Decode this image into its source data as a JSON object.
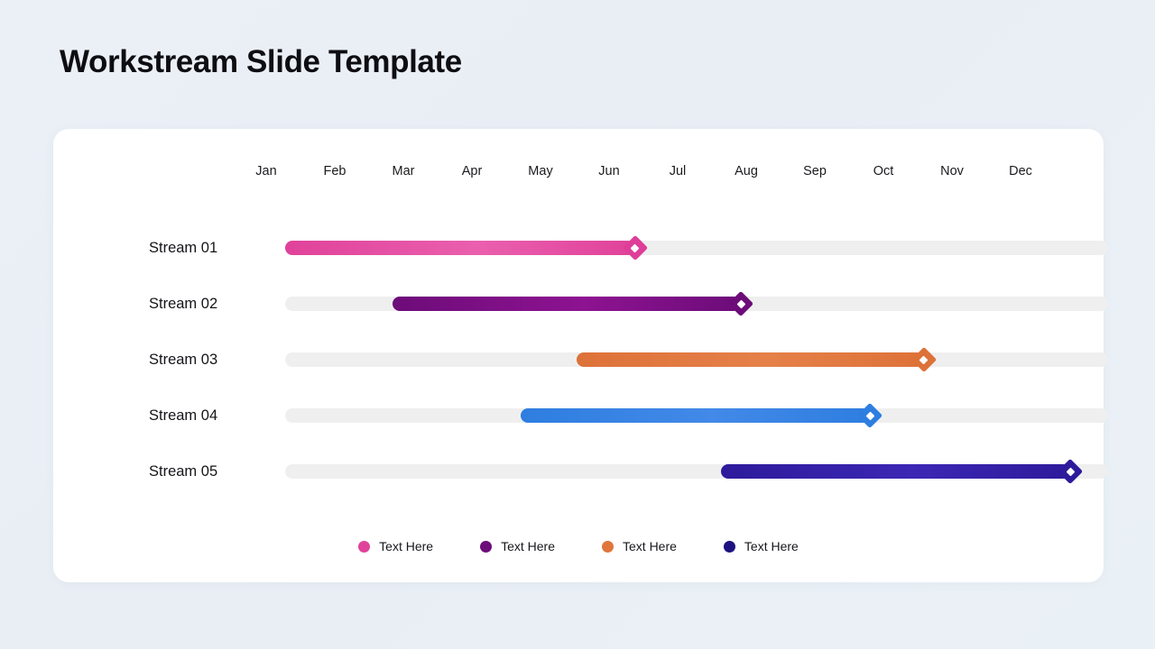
{
  "page": {
    "title": "Workstream Slide Template",
    "background_color": "#eaf0f6",
    "card_color": "#ffffff"
  },
  "timeline": {
    "track_color": "#efefef",
    "months": [
      "Jan",
      "Feb",
      "Mar",
      "Apr",
      "May",
      "Jun",
      "Jul",
      "Aug",
      "Sep",
      "Oct",
      "Nov",
      "Dec"
    ],
    "rows": [
      {
        "label": "Stream 01",
        "start_month": "Jan",
        "end_month": "Jun",
        "start_pct": 0,
        "end_pct": 42.5,
        "color": "#e0429a",
        "color_light": "#ea5fae",
        "marker_color": "#de3e98",
        "marker_inner_color": "#ffffff"
      },
      {
        "label": "Stream 02",
        "start_month": "Mar",
        "end_month": "Jul",
        "start_pct": 13.0,
        "end_pct": 55.4,
        "color": "#6d0c79",
        "color_light": "#8d1391",
        "marker_color": "#6d0c79",
        "marker_inner_color": "#ffffff"
      },
      {
        "label": "Stream 03",
        "start_month": "May",
        "end_month": "Oct",
        "start_pct": 35.4,
        "end_pct": 77.6,
        "color": "#dd7239",
        "color_light": "#e58049",
        "marker_color": "#dd7239",
        "marker_inner_color": "#ffffff"
      },
      {
        "label": "Stream 04",
        "start_month": "Apr",
        "end_month": "Sep",
        "start_pct": 28.6,
        "end_pct": 71.1,
        "color": "#2e7ee0",
        "color_light": "#4289e8",
        "marker_color": "#2e7ee0",
        "marker_inner_color": "#ffffff"
      },
      {
        "label": "Stream 05",
        "start_month": "Aug",
        "end_month": "Dec",
        "start_pct": 53.0,
        "end_pct": 95.4,
        "color": "#2d1b9b",
        "color_light": "#3b27b4",
        "marker_color": "#2d1b9b",
        "marker_inner_color": "#ffffff"
      }
    ]
  },
  "legend": {
    "items": [
      {
        "label": "Text Here",
        "color": "#e0429a"
      },
      {
        "label": "Text Here",
        "color": "#6d0c79"
      },
      {
        "label": "Text Here",
        "color": "#e0763c"
      },
      {
        "label": "Text Here",
        "color": "#1d1280"
      }
    ]
  }
}
